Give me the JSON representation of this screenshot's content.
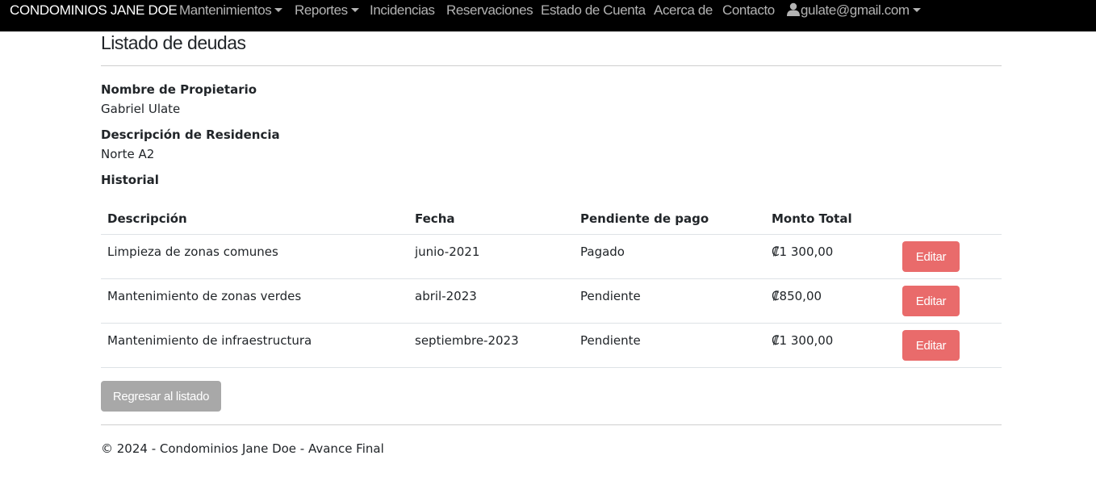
{
  "navbar": {
    "brand": "CONDOMINIOS JANE DOE",
    "items": [
      {
        "label": "Mantenimientos",
        "dropdown": true
      },
      {
        "label": "Reportes",
        "dropdown": true
      },
      {
        "label": "Incidencias",
        "dropdown": false
      },
      {
        "label": "Reservaciones",
        "dropdown": false
      },
      {
        "label": "Estado de Cuenta",
        "dropdown": false
      },
      {
        "label": "Acerca de",
        "dropdown": false
      },
      {
        "label": "Contacto",
        "dropdown": false
      }
    ],
    "user": {
      "icon": "user-icon",
      "email": "gulate@gmail.com"
    }
  },
  "page": {
    "title": "Listado de deudas"
  },
  "details": {
    "owner_label": "Nombre de Propietario",
    "owner_value": "Gabriel Ulate",
    "residence_label": "Descripción de Residencia",
    "residence_value": "Norte A2",
    "history_label": "Historial"
  },
  "table": {
    "headers": [
      "Descripción",
      "Fecha",
      "Pendiente de pago",
      "Monto Total"
    ],
    "rows": [
      {
        "descripcion": "Limpieza de zonas comunes",
        "fecha": "junio-2021",
        "estado": "Pagado",
        "monto": "₡1 300,00",
        "action": "Editar"
      },
      {
        "descripcion": "Mantenimiento de zonas verdes",
        "fecha": "abril-2023",
        "estado": "Pendiente",
        "monto": "₡850,00",
        "action": "Editar"
      },
      {
        "descripcion": "Mantenimiento de infraestructura",
        "fecha": "septiembre-2023",
        "estado": "Pendiente",
        "monto": "₡1 300,00",
        "action": "Editar"
      }
    ]
  },
  "actions": {
    "back_label": "Regresar al listado"
  },
  "footer": {
    "text": "© 2024 - Condominios Jane Doe - Avance Final"
  },
  "colors": {
    "navbar_bg": "#000000",
    "edit_button": "#e96b6b",
    "back_button": "#a8a8a8"
  }
}
